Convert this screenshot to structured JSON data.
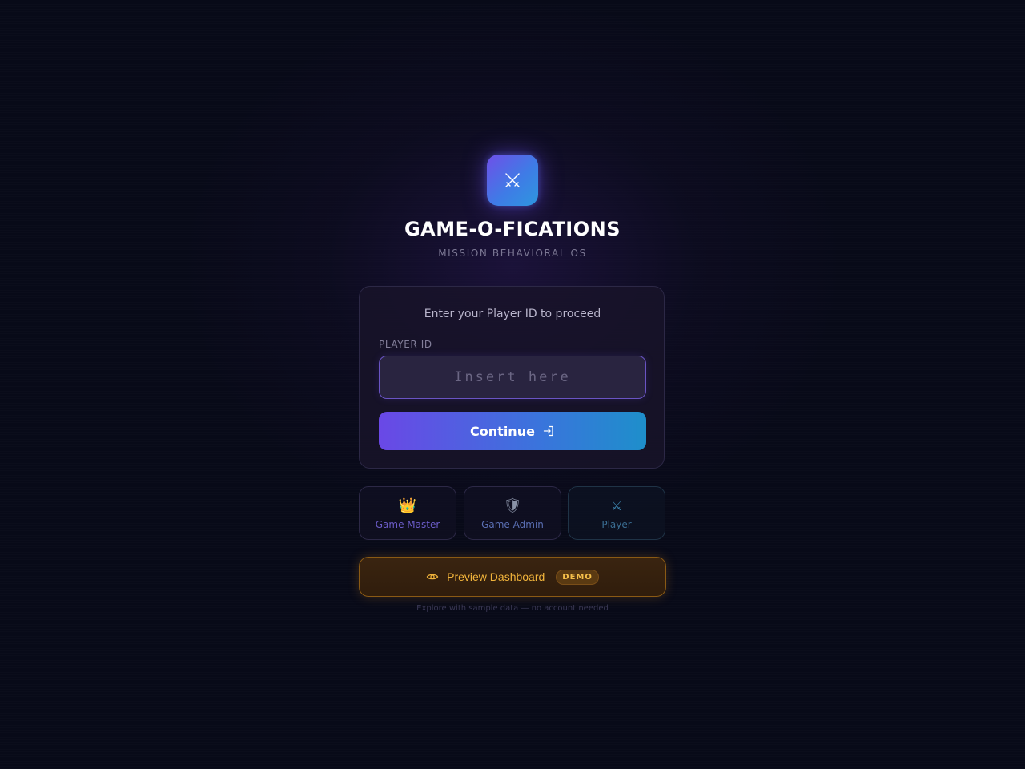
{
  "app": {
    "title": "GAME-O-FICATIONS",
    "subtitle": "MISSION BEHAVIORAL OS",
    "logo_icon": "crossed-swords-icon"
  },
  "login": {
    "prompt": "Enter your Player ID to proceed",
    "field_label": "PLAYER ID",
    "input_value": "",
    "input_placeholder": "Insert here",
    "continue_label": "Continue",
    "continue_icon": "log-in-icon"
  },
  "roles": [
    {
      "label": "Game Master",
      "icon": "crown-icon",
      "glyph": "👑"
    },
    {
      "label": "Game Admin",
      "icon": "shield-icon",
      "glyph": "🛡"
    },
    {
      "label": "Player",
      "icon": "crossed-swords-icon",
      "glyph": "⚔"
    }
  ],
  "preview": {
    "label": "Preview Dashboard",
    "badge": "DEMO",
    "icon": "eye-icon",
    "note": "Explore with sample data — no account needed"
  },
  "colors": {
    "background": "#080a18",
    "accent_purple": "#6a48e6",
    "accent_blue": "#1e8fcb",
    "demo_amber": "#f1b43b"
  }
}
